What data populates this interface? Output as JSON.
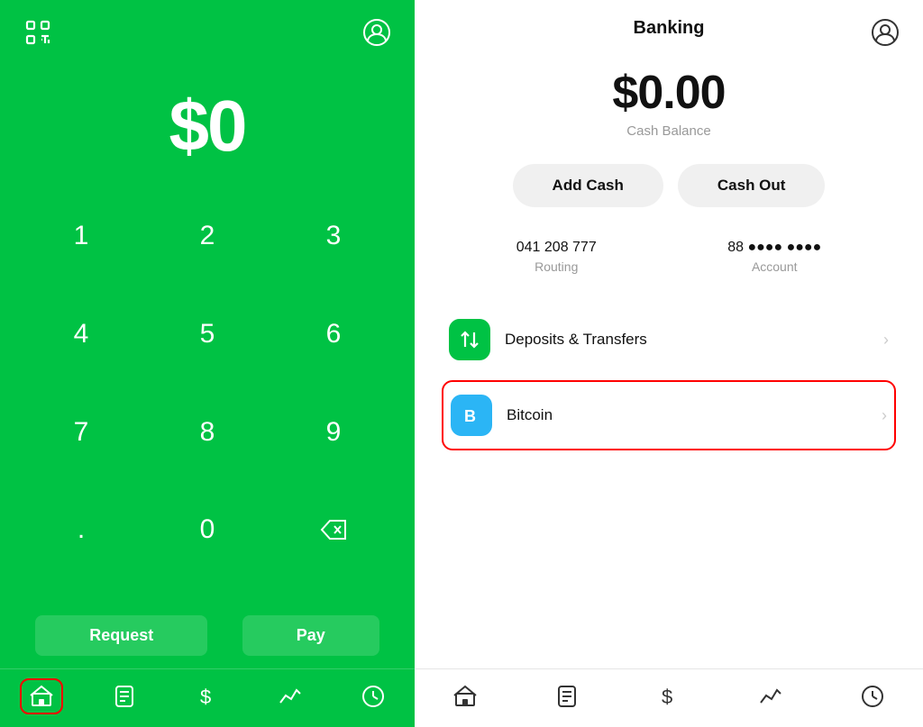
{
  "left": {
    "balance": "$0",
    "numpad": [
      "1",
      "2",
      "3",
      "4",
      "5",
      "6",
      "7",
      "8",
      "9",
      ".",
      "0",
      "⌫"
    ],
    "actions": {
      "request": "Request",
      "pay": "Pay"
    },
    "nav": [
      "home",
      "activity",
      "dollar",
      "chart",
      "clock"
    ]
  },
  "right": {
    "title": "Banking",
    "balance_amount": "$0.00",
    "balance_label": "Cash Balance",
    "add_cash": "Add Cash",
    "cash_out": "Cash Out",
    "routing_number": "041 208 777",
    "routing_label": "Routing",
    "account_number": "88 ●●●● ●●●●",
    "account_label": "Account",
    "menu_items": [
      {
        "id": "deposits",
        "icon_color": "green",
        "icon": "transfers",
        "label": "Deposits & Transfers",
        "highlighted": false
      },
      {
        "id": "bitcoin",
        "icon_color": "blue",
        "icon": "bitcoin",
        "label": "Bitcoin",
        "highlighted": true
      }
    ],
    "nav": [
      "home",
      "activity",
      "dollar",
      "chart",
      "clock"
    ]
  }
}
